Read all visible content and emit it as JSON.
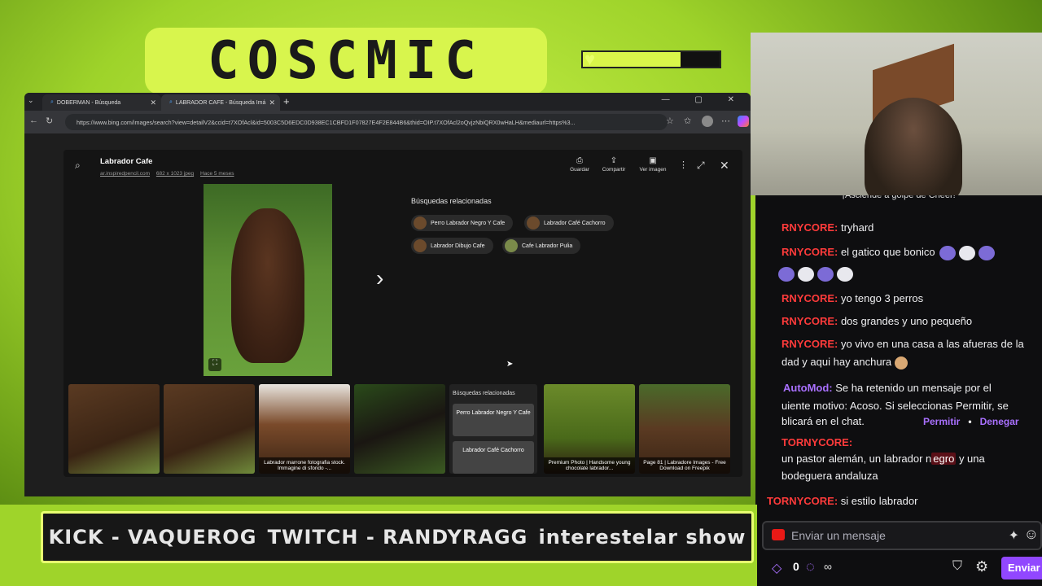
{
  "overlay": {
    "logo_text": "COSCMIC",
    "marquee": [
      "KICK -  VAQUEROG",
      "TWITCH - RANDYRAGG",
      "interestelar show"
    ]
  },
  "browser": {
    "tabs": [
      {
        "label": "DOBERMAN - Búsqueda"
      },
      {
        "label": "LABRADOR CAFE - Búsqueda Imá"
      }
    ],
    "new_tab": "+",
    "url": "https://www.bing.com/images/search?view=detailV2&ccid=t7XOfAcl&id=5003C5D6EDC0D938EC1CBFD1F07827E4F2E844B6&thid=OIP.t7XOfAcl2oQvjzNbiQRX0wHaLH&mediaurl=https%3..."
  },
  "modal": {
    "title": "Labrador Cafe",
    "source": "ar.inspiredpencil.com",
    "size": "682 x 1023 jpeg",
    "age": "Hace 5 meses",
    "actions": [
      {
        "label": "Guardar",
        "icon": "⎙"
      },
      {
        "label": "Compartir",
        "icon": "⇪"
      },
      {
        "label": "Ver imagen",
        "icon": "▣"
      }
    ],
    "related_heading": "Búsquedas relacionadas",
    "related": [
      "Perro Labrador Negro Y Cafe",
      "Labrador Café Cachorro",
      "Labrador Dibujo Cafe",
      "Cafe Labrador Pulia"
    ],
    "strip": {
      "captions": [
        "",
        "",
        "Labrador marrone fotografia stock. Immagine di sfondo -...",
        "",
        "Premium Photo | Handsome young chocolate labrador...",
        "Page 81 | Labradore Images - Free Download on Freepik"
      ],
      "related_heading": "Búsquedas relacionadas",
      "related_cards": [
        "Perro Labrador Negro Y Cafe",
        "Labrador Café Cachorro"
      ]
    }
  },
  "chat": {
    "header": "¡Asciende a golpe de Cheer!",
    "messages": [
      {
        "user": "RNYCORE:",
        "text": " tryhard"
      },
      {
        "user": "RNYCORE:",
        "text": " el gatico que bonico"
      },
      {
        "user": "RNYCORE:",
        "text": " yo tengo 3 perros"
      },
      {
        "user": "RNYCORE:",
        "text": " dos grandes y uno pequeño"
      },
      {
        "user": "RNYCORE:",
        "text": " yo vivo en una casa a las afueras de la"
      },
      {
        "user": "",
        "text": "dad y aqui hay anchura"
      }
    ],
    "automod": {
      "user": "AutoMod:",
      "line1": " Se ha retenido un mensaje por el",
      "line2": "uiente motivo: Acoso. Si seleccionas Permitir, se",
      "line3": "blicará en el chat.",
      "allow": "Permitir",
      "deny": "Denegar"
    },
    "held": {
      "user": "TORNYCORE:",
      "line1a": "un pastor alemán, un labrador n",
      "flag": "egro",
      "line1b": " y una",
      "line2": "bodeguera andaluza"
    },
    "last": {
      "user": "TORNYCORE:",
      "text": " si estilo labrador"
    },
    "input_placeholder": "Enviar un mensaje",
    "points": "0",
    "infinity": "∞",
    "send": "Enviar"
  }
}
